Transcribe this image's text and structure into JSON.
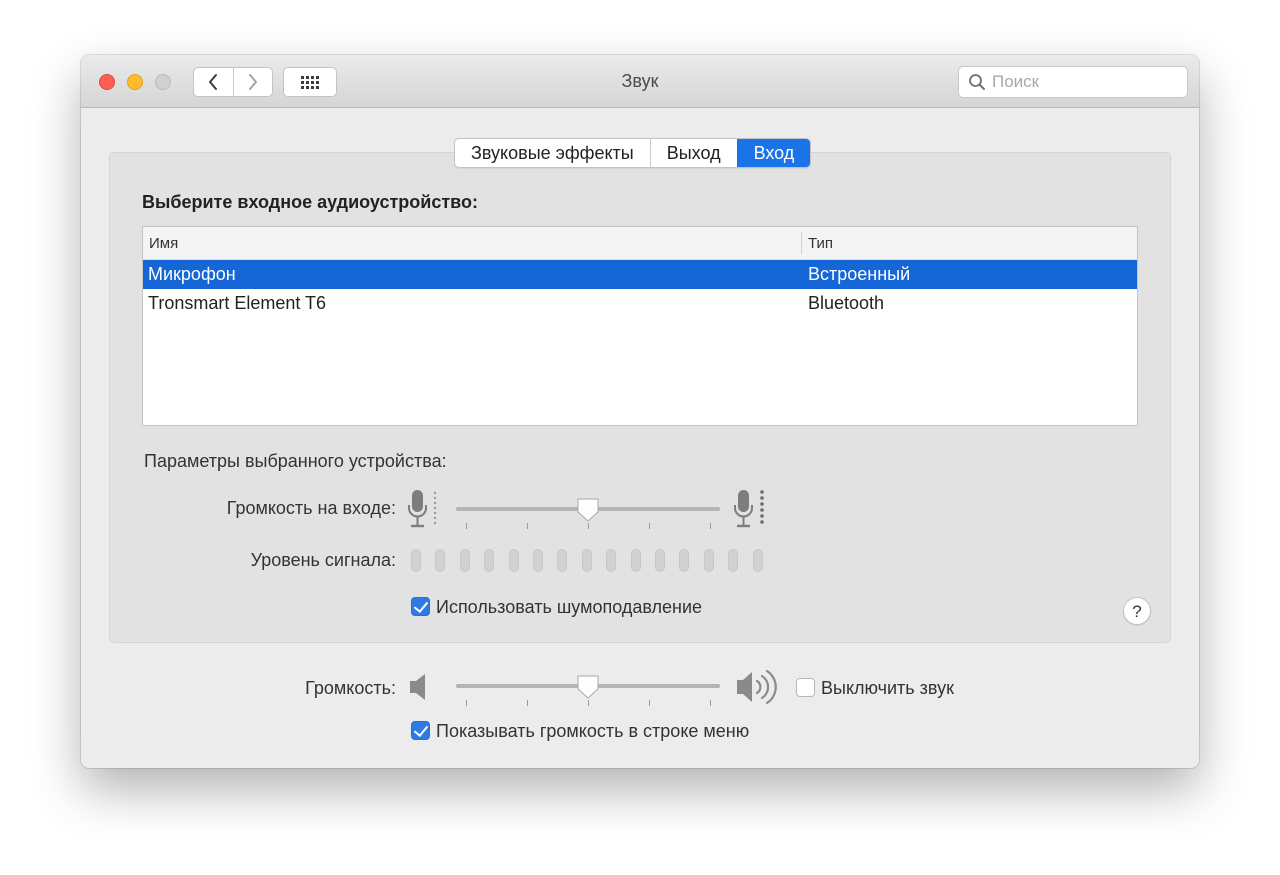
{
  "window": {
    "title": "Звук"
  },
  "search": {
    "placeholder": "Поиск"
  },
  "tabs": [
    {
      "label": "Звуковые эффекты",
      "active": false
    },
    {
      "label": "Выход",
      "active": false
    },
    {
      "label": "Вход",
      "active": true
    }
  ],
  "input_section": {
    "title": "Выберите входное аудиоустройство:",
    "columns": [
      "Имя",
      "Тип"
    ],
    "rows": [
      {
        "name": "Микрофон",
        "type": "Встроенный",
        "selected": true
      },
      {
        "name": "Tronsmart Element T6",
        "type": "Bluetooth",
        "selected": false
      }
    ]
  },
  "device_params": {
    "title": "Параметры выбранного устройства:",
    "input_volume_label": "Громкость на входе:",
    "input_volume_fraction": 0.5,
    "signal_level_label": "Уровень сигнала:",
    "signal_level_count": 15,
    "noise_reduction_label": "Использовать шумоподавление",
    "noise_reduction_checked": true
  },
  "output": {
    "volume_label": "Громкость:",
    "volume_fraction": 0.5,
    "mute_label": "Выключить звук",
    "mute_checked": false,
    "show_in_menu_label": "Показывать громкость в строке меню",
    "show_in_menu_checked": true
  },
  "help": {
    "label": "?"
  },
  "colors": {
    "accent": "#1a74e8",
    "selection": "#1566d6",
    "close": "#fe5f57",
    "minimize": "#febc2e"
  }
}
